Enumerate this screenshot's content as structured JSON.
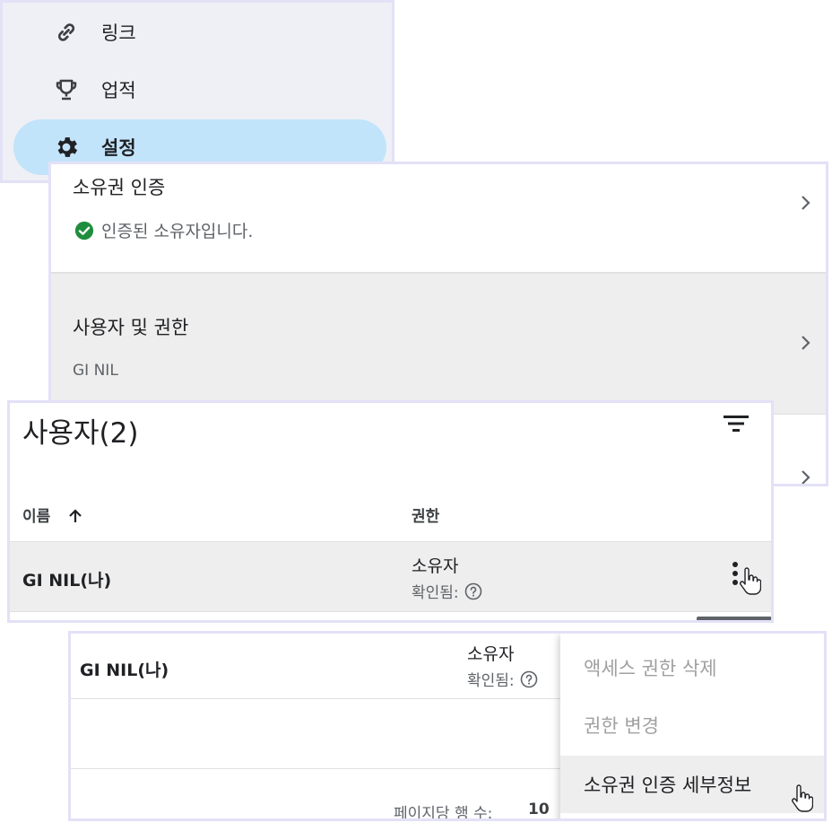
{
  "sidebar": {
    "items": [
      {
        "label": "링크",
        "icon": "link-icon"
      },
      {
        "label": "업적",
        "icon": "trophy-icon"
      },
      {
        "label": "설정",
        "icon": "gear-icon"
      }
    ]
  },
  "settings": {
    "ownership": {
      "title": "소유권 인증",
      "status": "인증된 소유자입니다."
    },
    "users_permissions": {
      "title": "사용자 및 권한",
      "sub": "GI NIL"
    }
  },
  "users_table": {
    "title": "사용자(2)",
    "col_name": "이름",
    "col_permission": "권한",
    "row": {
      "name": "GI NIL(나)",
      "role": "소유자",
      "verified": "확인됨:"
    }
  },
  "lower_table": {
    "row": {
      "name": "GI NIL(나)",
      "role": "소유자",
      "verified": "확인됨:"
    },
    "rows_per_page_label": "페이지당 행 수:",
    "rows_per_page_value": "10"
  },
  "menu": {
    "items": [
      {
        "label": "액세스 권한 삭제",
        "state": "disabled"
      },
      {
        "label": "권한 변경",
        "state": "disabled"
      },
      {
        "label": "소유권 인증 세부정보",
        "state": "hover"
      }
    ]
  },
  "colors": {
    "accent": "#c2e4fb",
    "success": "#1e8e3e"
  }
}
